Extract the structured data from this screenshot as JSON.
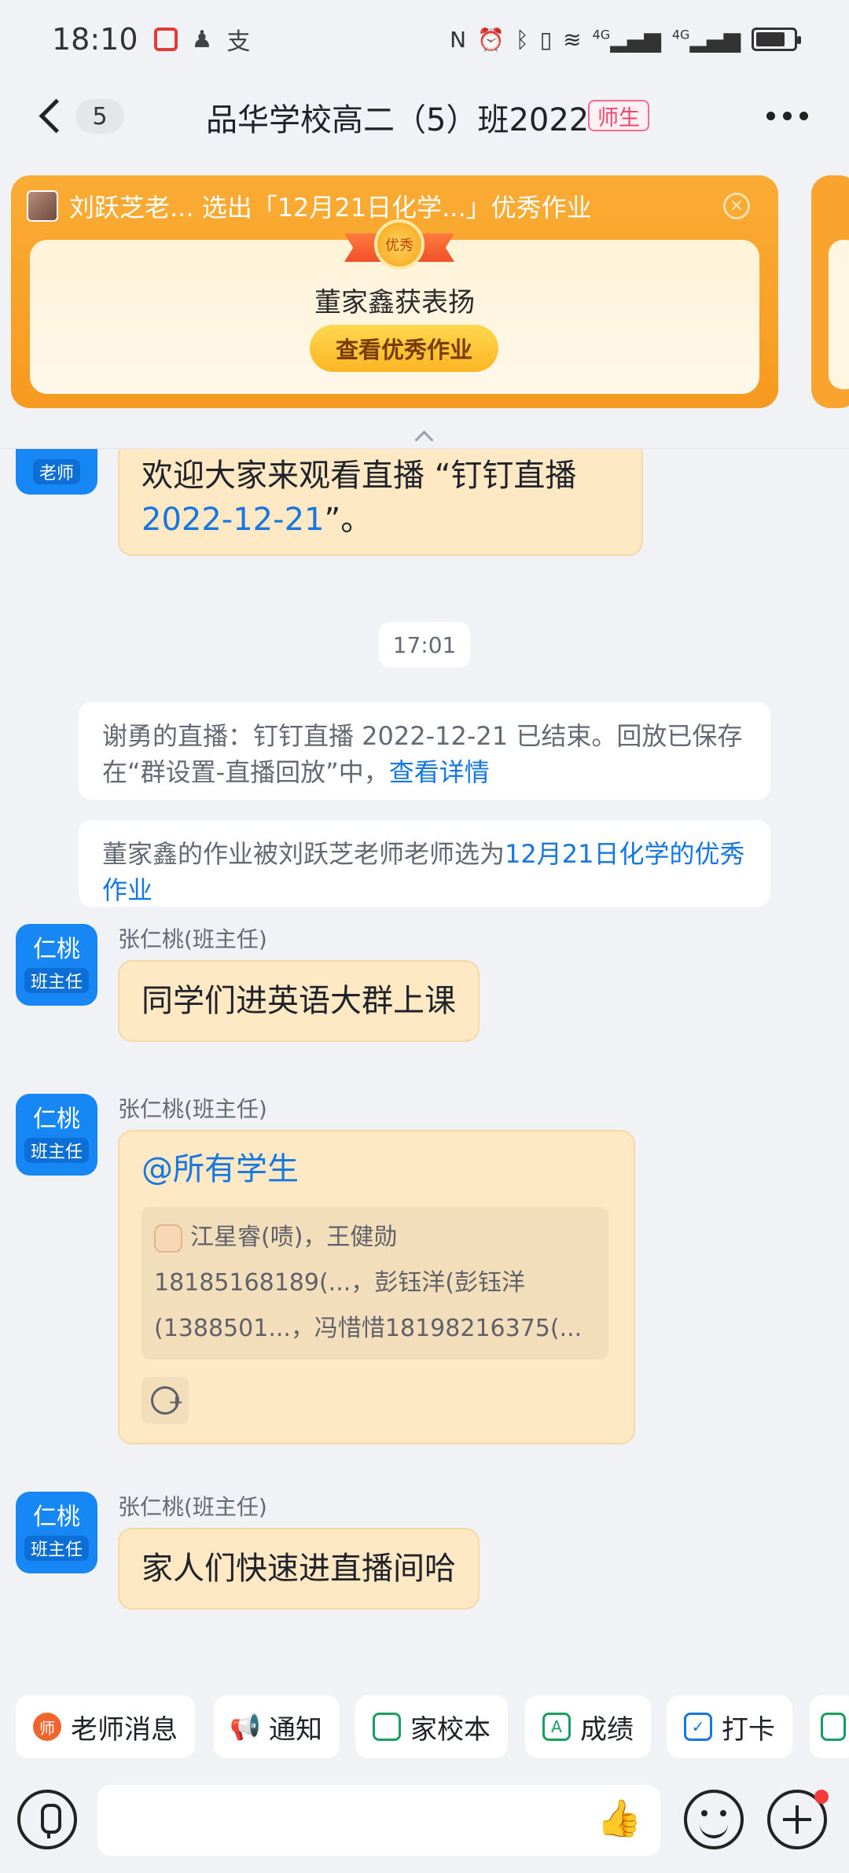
{
  "status_bar": {
    "time": "18:10",
    "network_left": "4G",
    "network_right": "4G"
  },
  "header": {
    "unread_count": "5",
    "title": "品华学校高二（5）班2022",
    "tag": "师生"
  },
  "banner": {
    "headline": "刘跃芝老... 选出「12月21日化学...」优秀作业",
    "badge": "优秀",
    "praise": "董家鑫获表扬",
    "button": "查看优秀作业"
  },
  "messages": {
    "live_invite": {
      "avatar_role": "老师",
      "text_pre": "欢迎大家来观看直播 “钉钉直播",
      "text_link": "2022-12-21",
      "text_post": "”。"
    },
    "time_divider": "17:01",
    "system_1": {
      "text": "谢勇的直播：钉钉直播 2022-12-21 已结束。回放已保存在“群设置-直播回放”中，",
      "link": "查看详情"
    },
    "system_2": {
      "text": "董家鑫的作业被刘跃芝老师老师选为",
      "link": "12月21日化学的优秀作业"
    },
    "msg_1": {
      "avatar_name": "仁桃",
      "avatar_role": "班主任",
      "sender": "张仁桃(班主任)",
      "text": "同学们进英语大群上课"
    },
    "msg_2": {
      "avatar_name": "仁桃",
      "avatar_role": "班主任",
      "sender": "张仁桃(班主任)",
      "mention": "@所有学生",
      "quote_line1": "江星睿(啧)，王健勋",
      "quote_line2": "18185168189(...，彭钰洋(彭钰洋",
      "quote_line3": "(1388501...，冯惜惜18198216375(..."
    },
    "msg_3": {
      "avatar_name": "仁桃",
      "avatar_role": "班主任",
      "sender": "张仁桃(班主任)",
      "text": "家人们快速进直播间哈"
    }
  },
  "quick_actions": [
    {
      "label": "老师消息",
      "icon": "teacher-message-icon",
      "color": "#F0652C"
    },
    {
      "label": "通知",
      "icon": "megaphone-icon",
      "color": "#F0652C"
    },
    {
      "label": "家校本",
      "icon": "notebook-icon",
      "color": "#16A05D"
    },
    {
      "label": "成绩",
      "icon": "grade-icon",
      "color": "#16A05D"
    },
    {
      "label": "打卡",
      "icon": "calendar-check-icon",
      "color": "#1677E0"
    }
  ],
  "colors": {
    "accent_blue": "#1687F5",
    "link_blue": "#1677E0",
    "banner_orange": "#F79A21",
    "bubble": "#FFE8C4"
  }
}
